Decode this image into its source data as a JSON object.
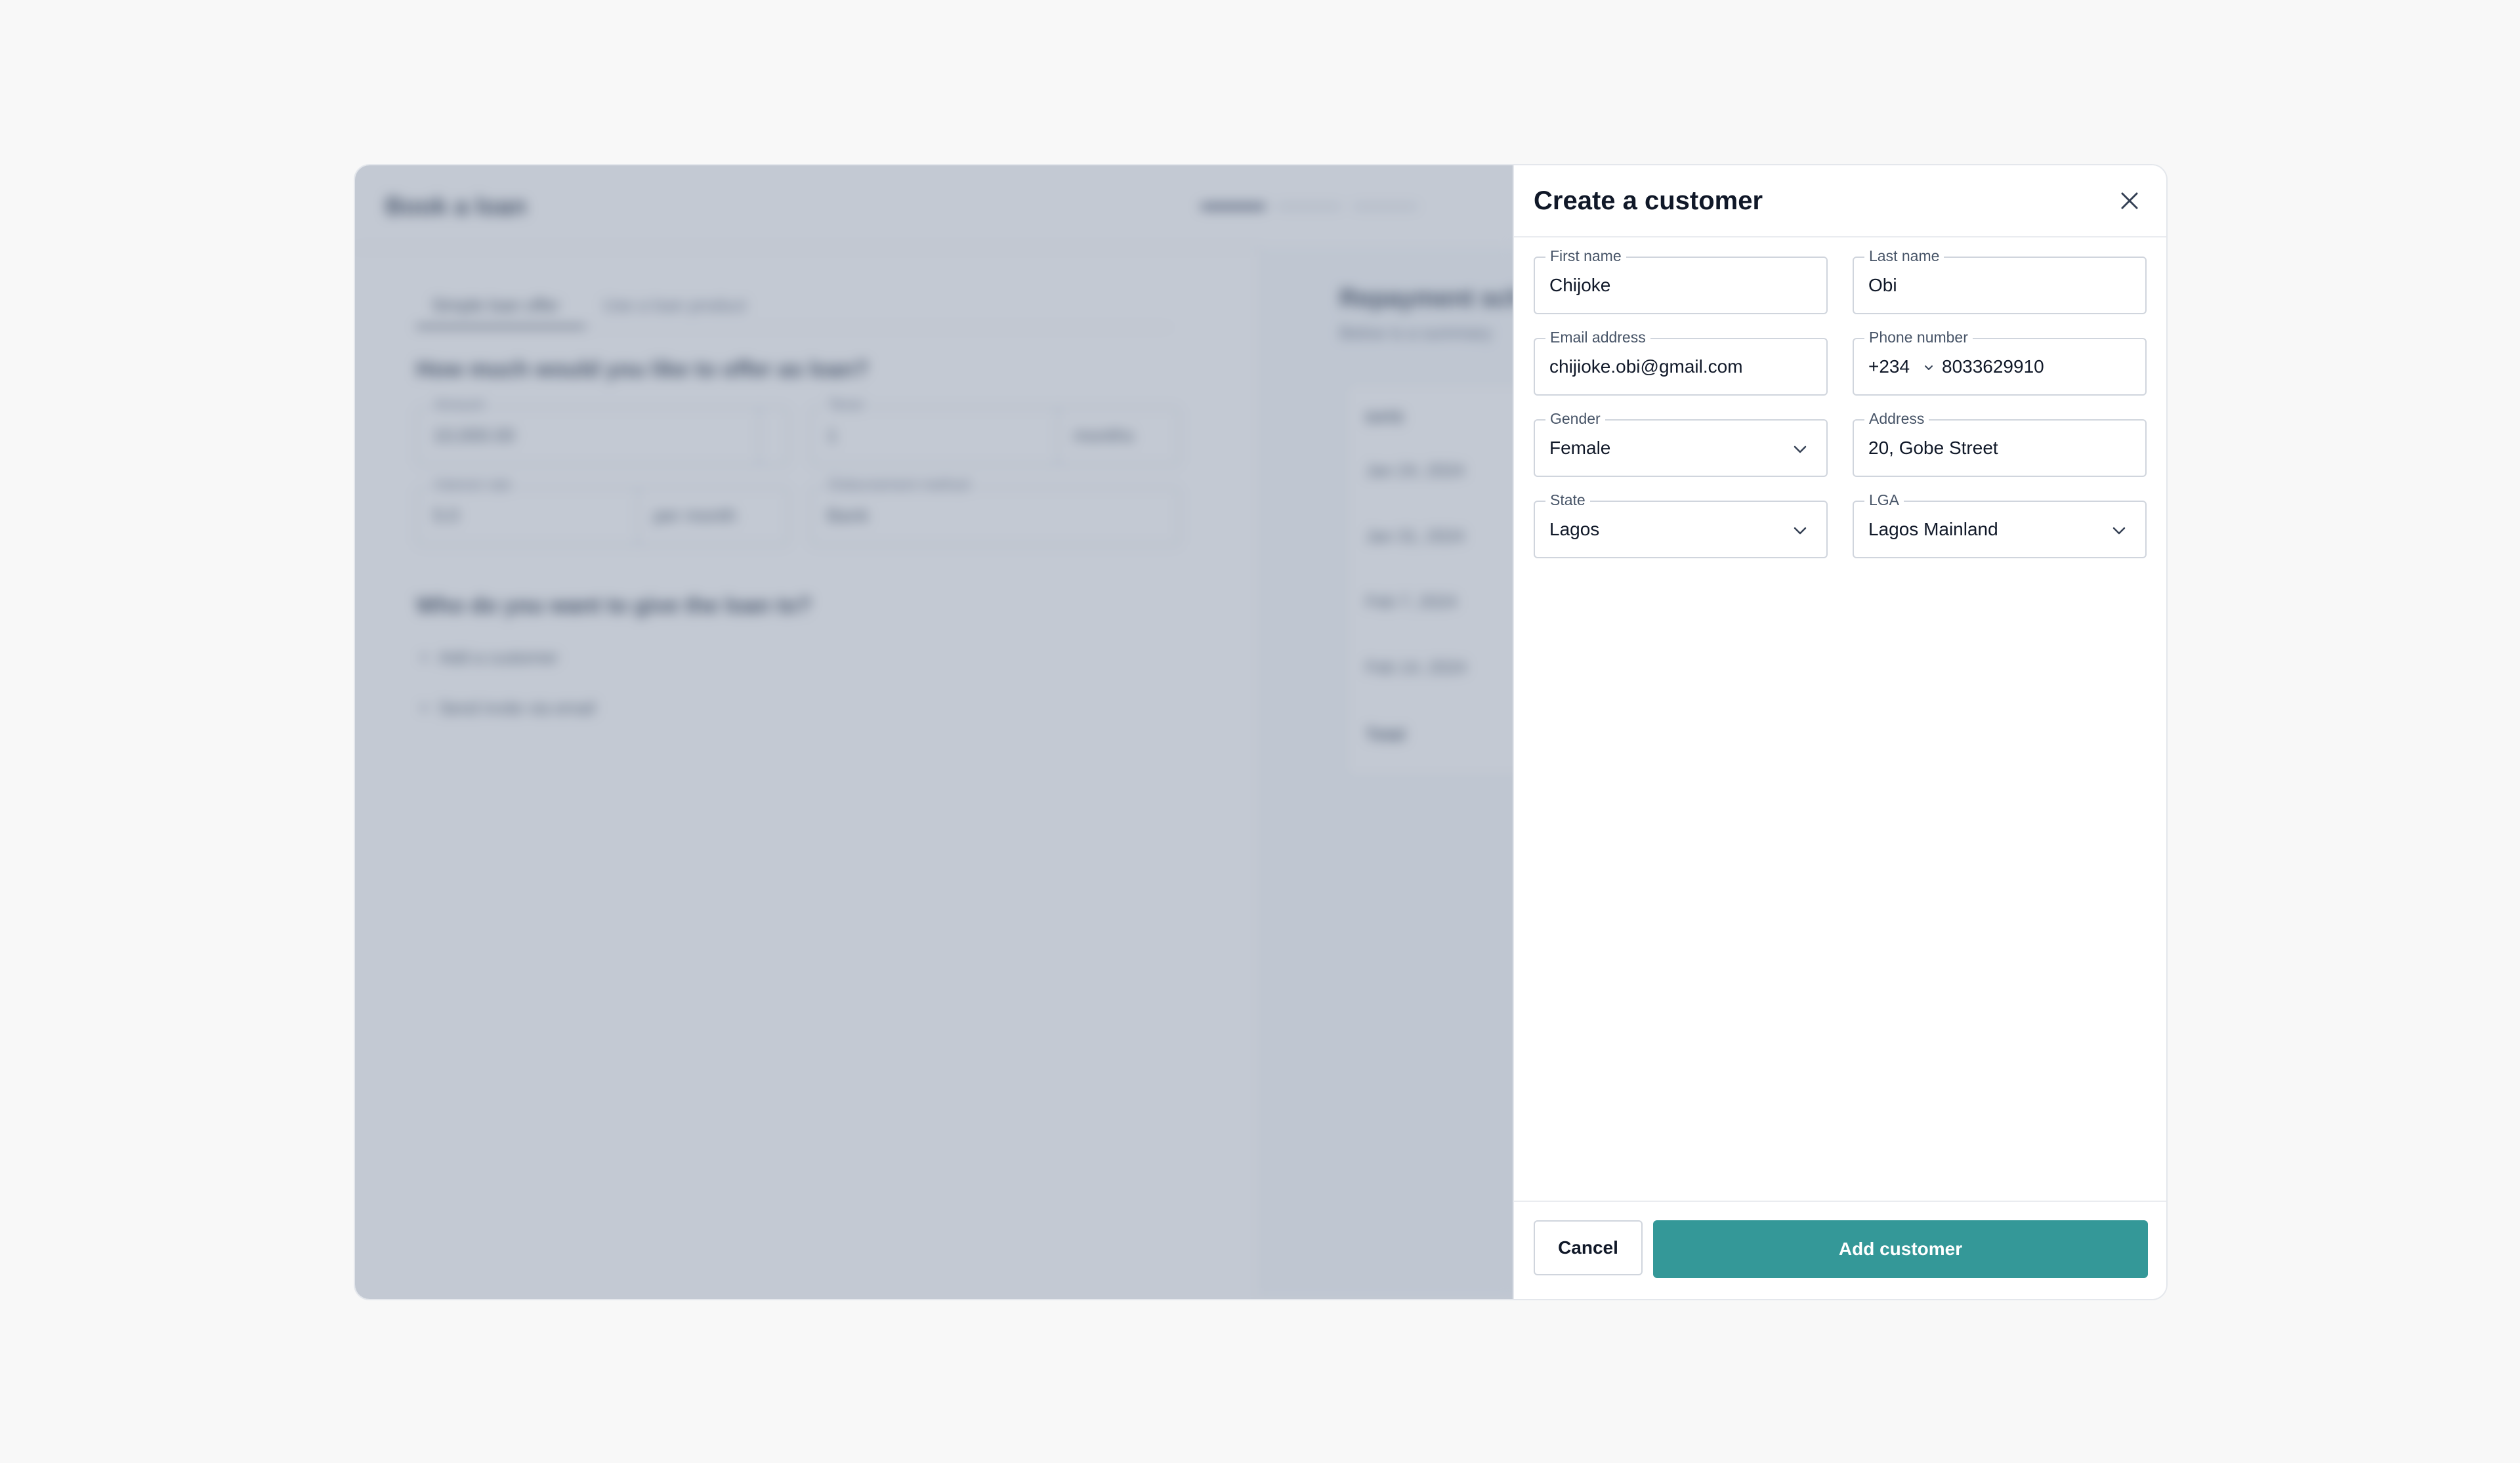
{
  "background": {
    "title": "Book a loan",
    "tabs": [
      "Simple loan offer",
      "Use a loan product"
    ],
    "question_amount": "How much would you like to offer as loan?",
    "amount": {
      "label": "Amount",
      "value": "10,000.00"
    },
    "tenor": {
      "label": "Tenor",
      "value": "1",
      "unit": "months"
    },
    "interest": {
      "label": "Interest rate",
      "value": "5.0",
      "unit": "per month"
    },
    "disbursement": {
      "label": "Disbursement method",
      "value": "Bank"
    },
    "question_recipient": "Who do you want to give the loan to?",
    "add_customer": "Add a customer",
    "send_invite": "Send invite via email",
    "schedule_title": "Repayment sch",
    "schedule_sub": "Below is a summary",
    "schedule_header": "DATE",
    "schedule_rows": [
      "Jan 24, 2024",
      "Jan 31, 2024",
      "Feb 7, 2024",
      "Feb 14, 2024"
    ],
    "schedule_total": "Total"
  },
  "drawer": {
    "title": "Create a customer",
    "fields": {
      "first_name": {
        "label": "First name",
        "value": "Chijoke"
      },
      "last_name": {
        "label": "Last name",
        "value": "Obi"
      },
      "email": {
        "label": "Email address",
        "value": "chijioke.obi@gmail.com"
      },
      "phone": {
        "label": "Phone number",
        "prefix": "+234",
        "value": "8033629910"
      },
      "gender": {
        "label": "Gender",
        "value": "Female"
      },
      "address": {
        "label": "Address",
        "value": "20, Gobe Street"
      },
      "state": {
        "label": "State",
        "value": "Lagos"
      },
      "lga": {
        "label": "LGA",
        "value": "Lagos Mainland"
      }
    },
    "cancel_label": "Cancel",
    "submit_label": "Add customer"
  },
  "icons": {
    "close": "close-icon",
    "chevron": "chevron-down-icon",
    "plus": "plus-icon"
  },
  "colors": {
    "primary": "#349898",
    "overlay": "#707e96",
    "border": "#d0d5dd"
  }
}
